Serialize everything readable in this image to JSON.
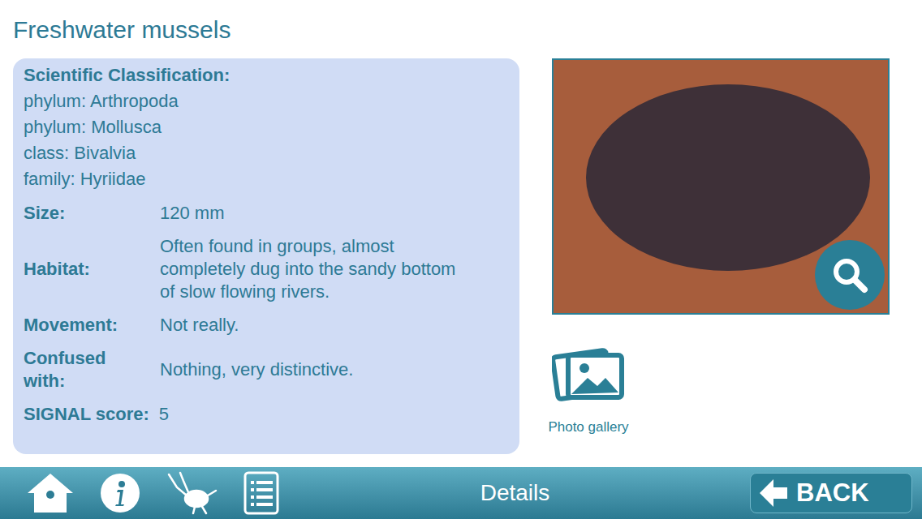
{
  "title": "Freshwater mussels",
  "classification": {
    "heading": "Scientific Classification:",
    "lines": [
      "phylum: Arthropoda",
      "phylum: Mollusca",
      "class: Bivalvia",
      "family: Hyriidae"
    ]
  },
  "fields": [
    {
      "label": "Size:",
      "value": "120 mm",
      "kind": "row"
    },
    {
      "label": "Habitat:",
      "value": "Often found in groups, almost completely dug into the sandy bottom of slow flowing rivers.",
      "kind": "row"
    },
    {
      "label": "Movement:",
      "value": "Not really.",
      "kind": "row"
    },
    {
      "label": "Confused with:",
      "value": "Nothing, very distinctive.",
      "kind": "row"
    },
    {
      "label": "SIGNAL score:",
      "value": "5",
      "kind": "inline"
    }
  ],
  "photo_gallery": {
    "label": "Photo gallery"
  },
  "nav": {
    "title": "Details",
    "back": "BACK"
  }
}
